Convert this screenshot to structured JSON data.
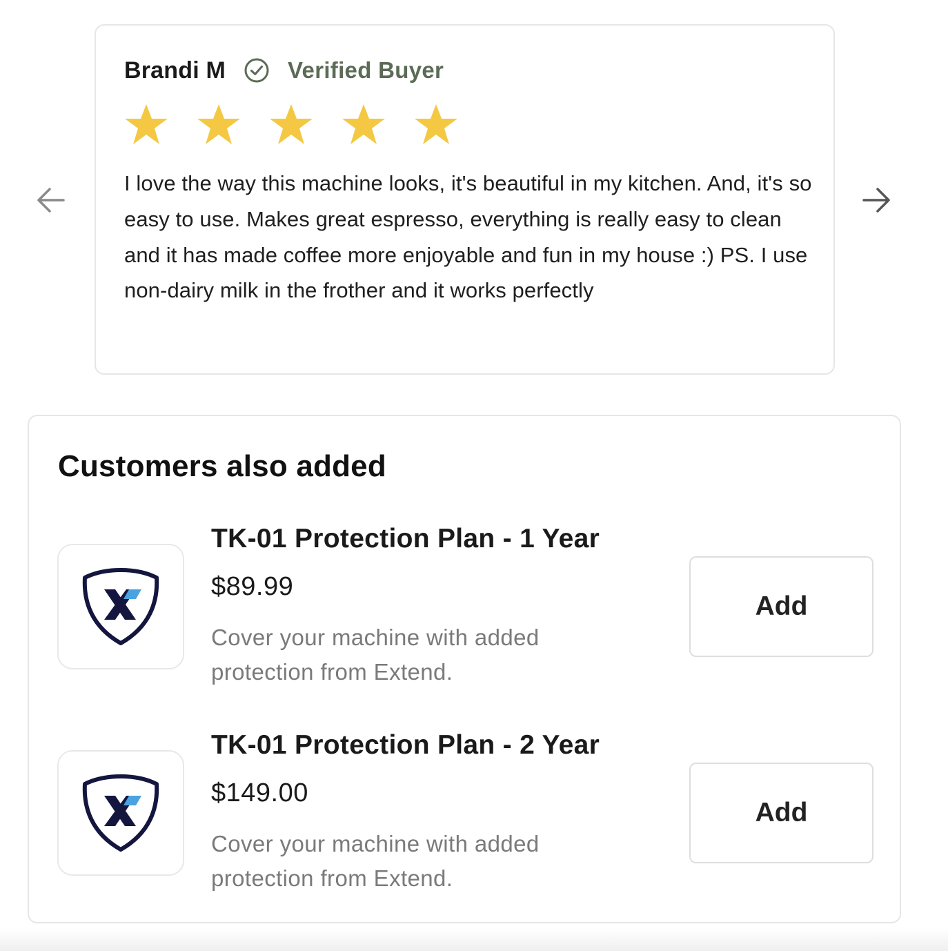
{
  "review": {
    "reviewer_name": "Brandi M",
    "verified_label": "Verified Buyer",
    "rating": 5,
    "rating_max": 5,
    "text": "I love the way this machine looks, it's beautiful in my kitchen. And, it's so easy to use. Makes great espresso, everything is really easy to clean and it has made coffee more enjoyable and fun in my house :) PS. I use non-dairy milk in the frother and it works perfectly",
    "prev_icon": "arrow-left-icon",
    "next_icon": "arrow-right-icon",
    "verified_icon": "check-circle-icon",
    "star_color": "#f4c842",
    "verified_color": "#5b6b55"
  },
  "customers_also_added": {
    "title": "Customers also added",
    "products": [
      {
        "name": "TK-01 Protection Plan - 1 Year",
        "price": "$89.99",
        "description": "Cover your machine with added protection from Extend.",
        "button_label": "Add",
        "icon": "extend-shield-logo-icon"
      },
      {
        "name": "TK-01 Protection Plan - 2 Year",
        "price": "$149.00",
        "description": "Cover your machine with added protection from Extend.",
        "button_label": "Add",
        "icon": "extend-shield-logo-icon"
      }
    ]
  }
}
